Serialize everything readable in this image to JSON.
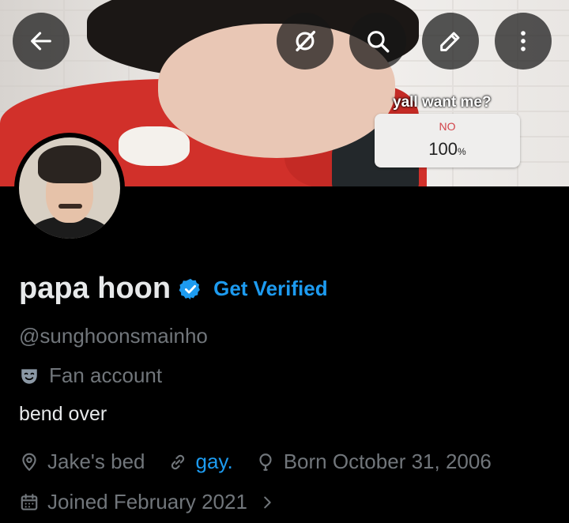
{
  "banner": {
    "poll_question": "yall want me?",
    "poll_option": "NO",
    "poll_percent": "100",
    "poll_percent_sign": "%"
  },
  "toolbar": {
    "back_icon": "arrow-left-icon",
    "grok_icon": "grok-icon",
    "search_icon": "search-icon",
    "edit_icon": "pencil-icon",
    "more_icon": "more-vertical-icon"
  },
  "profile": {
    "name": "papa hoon",
    "verified_badge_icon": "verified-badge-icon",
    "get_verified_label": "Get Verified",
    "handle": "@sunghoonsmainho",
    "category_icon": "theater-masks-icon",
    "category": "Fan account",
    "bio": "bend over",
    "location": "Jake's bed",
    "website": "gay.",
    "birthday": "Born October 31, 2006",
    "joined": "Joined February 2021"
  },
  "colors": {
    "background": "#000000",
    "text_primary": "#e7e9ea",
    "text_secondary": "#71767b",
    "accent": "#1d9bf0"
  }
}
